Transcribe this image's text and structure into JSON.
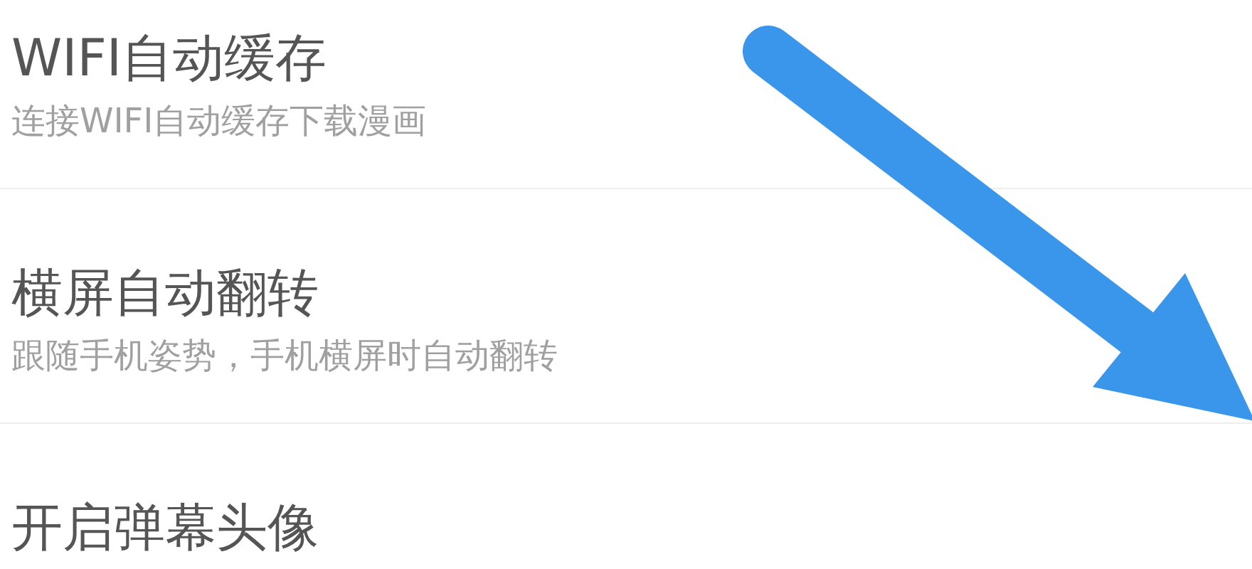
{
  "settings": [
    {
      "title": "WIFI自动缓存",
      "description": "连接WIFI自动缓存下载漫画"
    },
    {
      "title": "横屏自动翻转",
      "description": "跟随手机姿势，手机横屏时自动翻转"
    },
    {
      "title": "开启弹幕头像"
    }
  ]
}
